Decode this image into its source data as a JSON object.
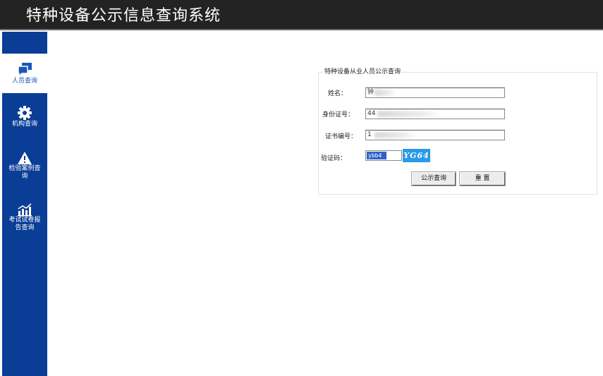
{
  "header": {
    "title": "特种设备公示信息查询系统"
  },
  "sidebar": {
    "items": [
      {
        "label": "人员查询",
        "icon": "chat-bubble-icon",
        "active": true
      },
      {
        "label": "机构查询",
        "icon": "gear-icon",
        "active": false
      },
      {
        "label": "检验案例查询",
        "icon": "warning-icon",
        "active": false
      },
      {
        "label": "考试试卷报告查询",
        "icon": "bar-chart-icon",
        "active": false
      }
    ]
  },
  "form": {
    "legend": "特种设备从业人员公示查询",
    "name_label": "姓名：",
    "name_value": "钟",
    "id_label": "身份证号：",
    "id_value": "44",
    "cert_label": "证书编号：",
    "cert_value": "1",
    "captcha_label": "验证码：",
    "captcha_input": "ybb4",
    "captcha_image_text": "YG64",
    "submit_label": "公示查询",
    "reset_label": "重 置"
  },
  "colors": {
    "header_bg": "#232323",
    "sidebar_bg": "#0a3d96",
    "captcha_bg": "#2a9be8"
  }
}
